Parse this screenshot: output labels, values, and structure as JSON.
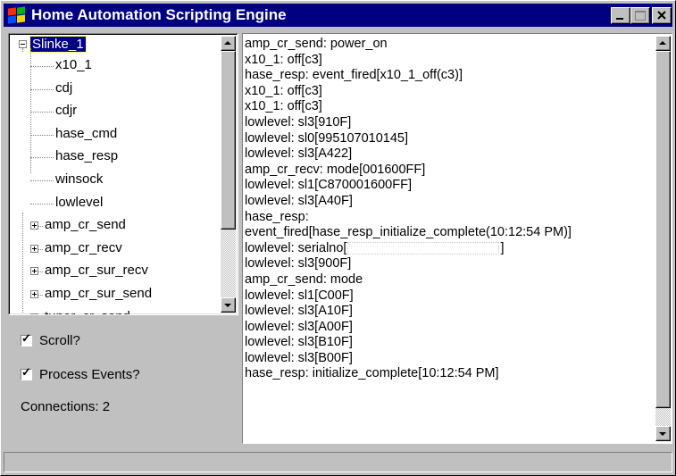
{
  "window": {
    "title": "Home Automation Scripting Engine",
    "title_bar_color": "#000080"
  },
  "title_buttons": [
    "minimize-icon",
    "maximize-icon",
    "close-icon"
  ],
  "tree": {
    "root": "Slinke_1",
    "children": [
      {
        "label": "x10_1",
        "expandable": false
      },
      {
        "label": "cdj",
        "expandable": false
      },
      {
        "label": "cdjr",
        "expandable": false
      },
      {
        "label": "hase_cmd",
        "expandable": false
      },
      {
        "label": "hase_resp",
        "expandable": false
      },
      {
        "label": "winsock",
        "expandable": false
      },
      {
        "label": "lowlevel",
        "expandable": false
      },
      {
        "label": "amp_cr_send",
        "expandable": true
      },
      {
        "label": "amp_cr_recv",
        "expandable": true
      },
      {
        "label": "amp_cr_sur_recv",
        "expandable": true
      },
      {
        "label": "amp_cr_sur_send",
        "expandable": true
      },
      {
        "label": "tuner_cr_send",
        "expandable": true
      }
    ]
  },
  "options": {
    "scroll_label": "Scroll?",
    "scroll_checked": true,
    "process_events_label": "Process Events?",
    "process_events_checked": true,
    "connections_text": "Connections: 2"
  },
  "log": [
    "amp_cr_send: power_on",
    "x10_1: off[c3]",
    "hase_resp: event_fired[x10_1_off(c3)]",
    "x10_1: off[c3]",
    "x10_1: off[c3]",
    "lowlevel: sl3[910F]",
    "lowlevel: sl0[995107010145]",
    "lowlevel: sl3[A422]",
    "amp_cr_recv: mode[001600FF]",
    "lowlevel: sl1[C870001600FF]",
    "lowlevel: sl3[A40F]",
    "hase_resp:",
    "event_fired[hase_resp_initialize_complete(10:12:54 PM)]",
    "lowlevel: serialno[",
    "lowlevel: sl3[900F]",
    "amp_cr_send: mode",
    "lowlevel: sl1[C00F]",
    "lowlevel: sl3[A10F]",
    "lowlevel: sl3[A00F]",
    "lowlevel: sl3[B10F]",
    "lowlevel: sl3[B00F]",
    "hase_resp: initialize_complete[10:12:54 PM]"
  ],
  "log_serial_suffix": "]"
}
